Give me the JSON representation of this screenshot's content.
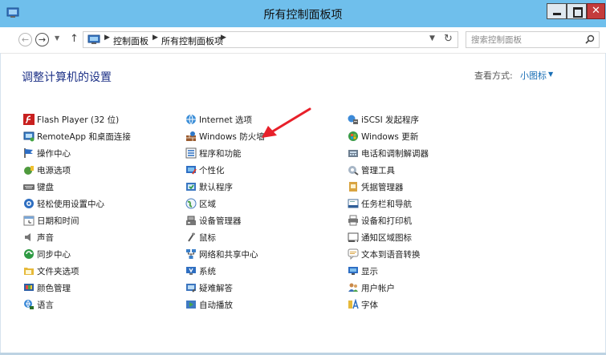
{
  "window": {
    "title": "所有控制面板项"
  },
  "toolbar": {
    "breadcrumbs": [
      "控制面板",
      "所有控制面板项"
    ],
    "search_placeholder": "搜索控制面板"
  },
  "header": {
    "title": "调整计算机的设置",
    "view_by_label": "查看方式:",
    "view_by_value": "小图标"
  },
  "items": {
    "col1": [
      {
        "label": "Flash Player (32 位)",
        "icon": "flash-icon"
      },
      {
        "label": "RemoteApp 和桌面连接",
        "icon": "remoteapp-icon"
      },
      {
        "label": "操作中心",
        "icon": "flag-icon"
      },
      {
        "label": "电源选项",
        "icon": "power-icon"
      },
      {
        "label": "键盘",
        "icon": "keyboard-icon"
      },
      {
        "label": "轻松使用设置中心",
        "icon": "ease-of-access-icon"
      },
      {
        "label": "日期和时间",
        "icon": "clock-icon"
      },
      {
        "label": "声音",
        "icon": "speaker-icon"
      },
      {
        "label": "同步中心",
        "icon": "sync-icon"
      },
      {
        "label": "文件夹选项",
        "icon": "folder-icon"
      },
      {
        "label": "颜色管理",
        "icon": "color-management-icon"
      },
      {
        "label": "语言",
        "icon": "language-icon"
      }
    ],
    "col2": [
      {
        "label": "Internet 选项",
        "icon": "internet-icon"
      },
      {
        "label": "Windows 防火墙",
        "icon": "firewall-icon"
      },
      {
        "label": "程序和功能",
        "icon": "programs-icon"
      },
      {
        "label": "个性化",
        "icon": "personalize-icon"
      },
      {
        "label": "默认程序",
        "icon": "default-programs-icon"
      },
      {
        "label": "区域",
        "icon": "region-icon"
      },
      {
        "label": "设备管理器",
        "icon": "device-manager-icon"
      },
      {
        "label": "鼠标",
        "icon": "mouse-icon"
      },
      {
        "label": "网络和共享中心",
        "icon": "network-icon"
      },
      {
        "label": "系统",
        "icon": "system-icon"
      },
      {
        "label": "疑难解答",
        "icon": "troubleshoot-icon"
      },
      {
        "label": "自动播放",
        "icon": "autoplay-icon"
      }
    ],
    "col3": [
      {
        "label": "iSCSI 发起程序",
        "icon": "iscsi-icon"
      },
      {
        "label": "Windows 更新",
        "icon": "windows-update-icon"
      },
      {
        "label": "电话和调制解调器",
        "icon": "phone-modem-icon"
      },
      {
        "label": "管理工具",
        "icon": "admin-tools-icon"
      },
      {
        "label": "凭据管理器",
        "icon": "credential-icon"
      },
      {
        "label": "任务栏和导航",
        "icon": "taskbar-icon"
      },
      {
        "label": "设备和打印机",
        "icon": "printer-icon"
      },
      {
        "label": "通知区域图标",
        "icon": "notification-area-icon"
      },
      {
        "label": "文本到语音转换",
        "icon": "text-to-speech-icon"
      },
      {
        "label": "显示",
        "icon": "display-icon"
      },
      {
        "label": "用户帐户",
        "icon": "user-accounts-icon"
      },
      {
        "label": "字体",
        "icon": "fonts-icon"
      }
    ]
  },
  "colors": {
    "titlebar": "#6fbfec",
    "heading": "#1e3287",
    "link": "#1a6fb5",
    "annotation_arrow": "#e8202a"
  }
}
